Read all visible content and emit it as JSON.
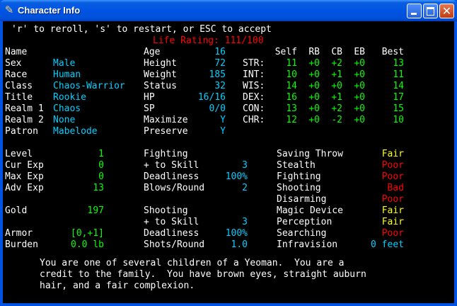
{
  "window": {
    "title": "Character Info",
    "icon": "quill-icon",
    "controls": [
      "minimize",
      "maximize",
      "close"
    ]
  },
  "colors": {
    "title_bar": "#0054e3",
    "background": "#000000",
    "label": "#ffffff",
    "value_cyan": "#00d0ff",
    "value_green": "#00ff00",
    "value_red": "#ff0000",
    "value_yellow": "#ffff00"
  },
  "header": {
    "instructions": "'r' to reroll, 's' to restart, or ESC to accept",
    "life_rating": "Life Rating: 111/100"
  },
  "identity": [
    {
      "label": "Name",
      "value": ""
    },
    {
      "label": "Sex",
      "value": "Male"
    },
    {
      "label": "Race",
      "value": "Human"
    },
    {
      "label": "Class",
      "value": "Chaos-Warrior"
    },
    {
      "label": "Title",
      "value": "Rookie"
    },
    {
      "label": "Realm 1",
      "value": "Chaos"
    },
    {
      "label": "Realm 2",
      "value": "None"
    },
    {
      "label": "Patron",
      "value": "Mabelode"
    }
  ],
  "physical": [
    {
      "label": "Age",
      "value": "16"
    },
    {
      "label": "Height",
      "value": "72"
    },
    {
      "label": "Weight",
      "value": "185"
    },
    {
      "label": "Status",
      "value": "32"
    },
    {
      "label": "HP",
      "value": "16/16"
    },
    {
      "label": "SP",
      "value": "0/0"
    },
    {
      "label": "Maximize",
      "value": "Y"
    },
    {
      "label": "Preserve",
      "value": "Y"
    }
  ],
  "stats": {
    "headers": [
      "Self",
      "RB",
      "CB",
      "EB",
      "Best"
    ],
    "rows": [
      {
        "name": "STR:",
        "self": "11",
        "rb": "+0",
        "cb": "+2",
        "eb": "+0",
        "best": "13"
      },
      {
        "name": "INT:",
        "self": "10",
        "rb": "+0",
        "cb": "+1",
        "eb": "+0",
        "best": "11"
      },
      {
        "name": "WIS:",
        "self": "14",
        "rb": "+0",
        "cb": "+0",
        "eb": "+0",
        "best": "14"
      },
      {
        "name": "DEX:",
        "self": "16",
        "rb": "+0",
        "cb": "+1",
        "eb": "+0",
        "best": "17"
      },
      {
        "name": "CON:",
        "self": "13",
        "rb": "+0",
        "cb": "+2",
        "eb": "+0",
        "best": "15"
      },
      {
        "name": "CHR:",
        "self": "12",
        "rb": "+0",
        "cb": "-2",
        "eb": "+0",
        "best": "10"
      }
    ]
  },
  "progress": [
    {
      "label": "Level",
      "value": "1"
    },
    {
      "label": "Cur Exp",
      "value": "0"
    },
    {
      "label": "Max Exp",
      "value": "0"
    },
    {
      "label": "Adv Exp",
      "value": "13"
    }
  ],
  "gold": {
    "label": "Gold",
    "value": "197"
  },
  "armor": {
    "label": "Armor",
    "value": "[0,+1]"
  },
  "burden": {
    "label": "Burden",
    "value": "0.0 lb"
  },
  "fighting": {
    "heading": "Fighting",
    "rows": [
      {
        "label": "+ to Skill",
        "value": "3"
      },
      {
        "label": "Deadliness",
        "value": "100%"
      },
      {
        "label": "Blows/Round",
        "value": "2"
      }
    ]
  },
  "shooting": {
    "heading": "Shooting",
    "rows": [
      {
        "label": "+ to Skill",
        "value": "3"
      },
      {
        "label": "Deadliness",
        "value": "100%"
      },
      {
        "label": "Shots/Round",
        "value": "1.0"
      }
    ]
  },
  "skills": [
    {
      "label": "Saving Throw",
      "value": "Fair",
      "color": "#ffff00"
    },
    {
      "label": "Stealth",
      "value": "Poor",
      "color": "#ff0000"
    },
    {
      "label": "Fighting",
      "value": "Poor",
      "color": "#ff0000"
    },
    {
      "label": "Shooting",
      "value": "Bad",
      "color": "#ff0000"
    },
    {
      "label": "Disarming",
      "value": "Poor",
      "color": "#ff0000"
    },
    {
      "label": "Magic Device",
      "value": "Fair",
      "color": "#ffff00"
    },
    {
      "label": "Perception",
      "value": "Fair",
      "color": "#ffff00"
    },
    {
      "label": "Searching",
      "value": "Poor",
      "color": "#ff0000"
    },
    {
      "label": "Infravision",
      "value": "0 feet",
      "color": "#00d0ff"
    }
  ],
  "history": [
    "You are one of several children of a Yeoman.  You are a",
    "credit to the family.  You have brown eyes, straight auburn",
    "hair, and a fair complexion."
  ]
}
